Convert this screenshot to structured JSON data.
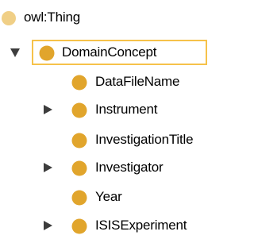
{
  "tree": {
    "colors": {
      "class_bullet": "#e1a52c",
      "root_bullet": "#f0cf86",
      "selection_border": "#f6c24a",
      "toggle": "#3d3d3d"
    },
    "nodes": [
      {
        "label": "owl:Thing",
        "toggle": "none",
        "bullet": "root"
      },
      {
        "label": "DomainConcept",
        "toggle": "expanded",
        "bullet": "class",
        "selected": true
      },
      {
        "label": "DataFileName",
        "toggle": "none",
        "bullet": "class"
      },
      {
        "label": "Instrument",
        "toggle": "collapsed",
        "bullet": "class"
      },
      {
        "label": "InvestigationTitle",
        "toggle": "none",
        "bullet": "class"
      },
      {
        "label": "Investigator",
        "toggle": "collapsed",
        "bullet": "class"
      },
      {
        "label": "Year",
        "toggle": "none",
        "bullet": "class"
      },
      {
        "label": "ISISExperiment",
        "toggle": "collapsed",
        "bullet": "class"
      }
    ]
  }
}
